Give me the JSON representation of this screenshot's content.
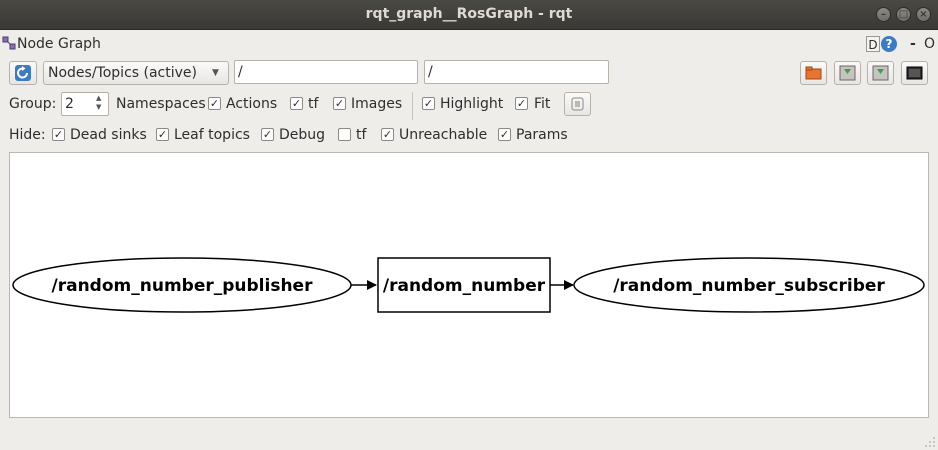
{
  "window": {
    "title": "rqt_graph__RosGraph - rqt"
  },
  "plugin": {
    "title": "Node Graph",
    "d_label": "D",
    "help_label": "?",
    "min_label": "-",
    "close_label": "O"
  },
  "toolbar": {
    "mode_selected": "Nodes/Topics (active)",
    "node_filter_value": "/",
    "topic_filter_value": "/"
  },
  "options": {
    "group_label": "Group:",
    "group_value": "2",
    "namespaces": "Namespaces",
    "actions": "Actions",
    "tf": "tf",
    "images": "Images",
    "highlight": "Highlight",
    "fit": "Fit"
  },
  "hide": {
    "label": "Hide:",
    "dead_sinks": "Dead sinks",
    "leaf_topics": "Leaf topics",
    "debug": "Debug",
    "tf": "tf",
    "unreachable": "Unreachable",
    "params": "Params"
  },
  "graph": {
    "publisher": "/random_number_publisher",
    "topic": "/random_number",
    "subscriber": "/random_number_subscriber"
  },
  "colors": {
    "refresh_icon": "#3b7bc4",
    "titlebar": "#3c3b37"
  }
}
